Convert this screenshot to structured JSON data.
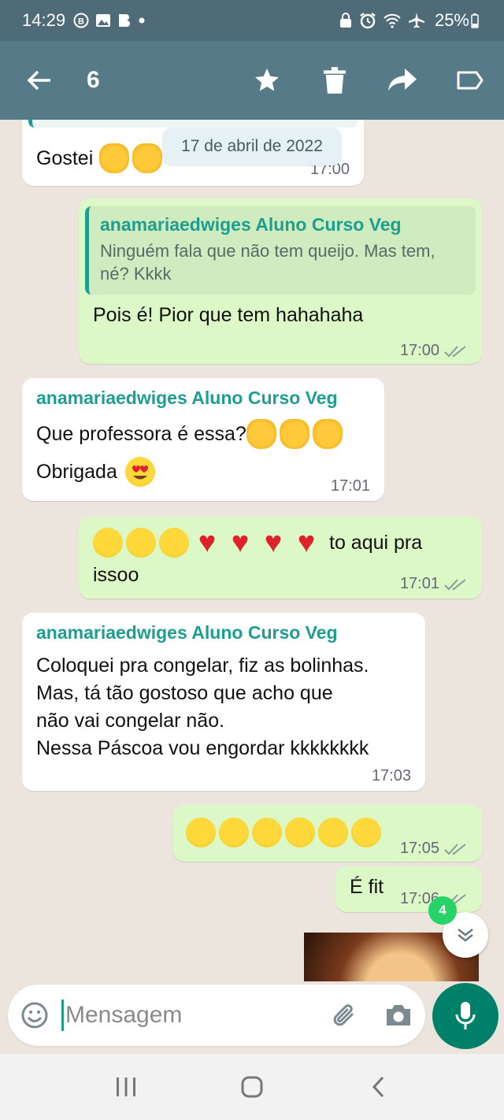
{
  "status_bar": {
    "time": "14:29",
    "battery": "25%",
    "icons": [
      "b-circle-icon",
      "image-icon",
      "b-app-icon",
      "dot-icon",
      "lock-icon",
      "alarm-icon",
      "wifi-icon",
      "airplane-icon",
      "battery-icon"
    ]
  },
  "selection_bar": {
    "count": "6",
    "actions": [
      "star-icon",
      "delete-icon",
      "forward-icon",
      "label-icon"
    ]
  },
  "date_chip": "17 de abril de 2022",
  "messages": [
    {
      "dir": "in",
      "text": "Gostei",
      "time": "17:00"
    },
    {
      "dir": "out",
      "quote_sender": "anamariaedwiges Aluno Curso Veg",
      "quote_text": "Ninguém fala que não tem queijo. Mas tem, né? Kkkk",
      "text": "Pois é! Pior que tem hahahaha",
      "time": "17:00"
    },
    {
      "dir": "in",
      "sender": "anamariaedwiges Aluno Curso Veg",
      "text": "Que professora é essa?",
      "text2": "Obrigada",
      "time": "17:01"
    },
    {
      "dir": "out",
      "text": "to aqui pra",
      "text2": "issoo",
      "time": "17:01"
    },
    {
      "dir": "in",
      "sender": "anamariaedwiges Aluno Curso Veg",
      "lines": [
        "Coloquei pra congelar, fiz as bolinhas.",
        "Mas, tá tão gostoso que acho que",
        "não vai congelar não.",
        "Nessa Páscoa vou engordar kkkkkkkk"
      ],
      "time": "17:03"
    },
    {
      "dir": "out",
      "text": "",
      "time": "17:05"
    },
    {
      "dir": "out",
      "text": "É fit",
      "time": "17:06"
    }
  ],
  "unread_badge": "4",
  "composer": {
    "placeholder": "Mensagem"
  },
  "colors": {
    "header": "#577A89",
    "status": "#4F6B77",
    "out_bubble": "#DCF8C6",
    "accent": "#008069",
    "sender": "#1E9E8F"
  }
}
